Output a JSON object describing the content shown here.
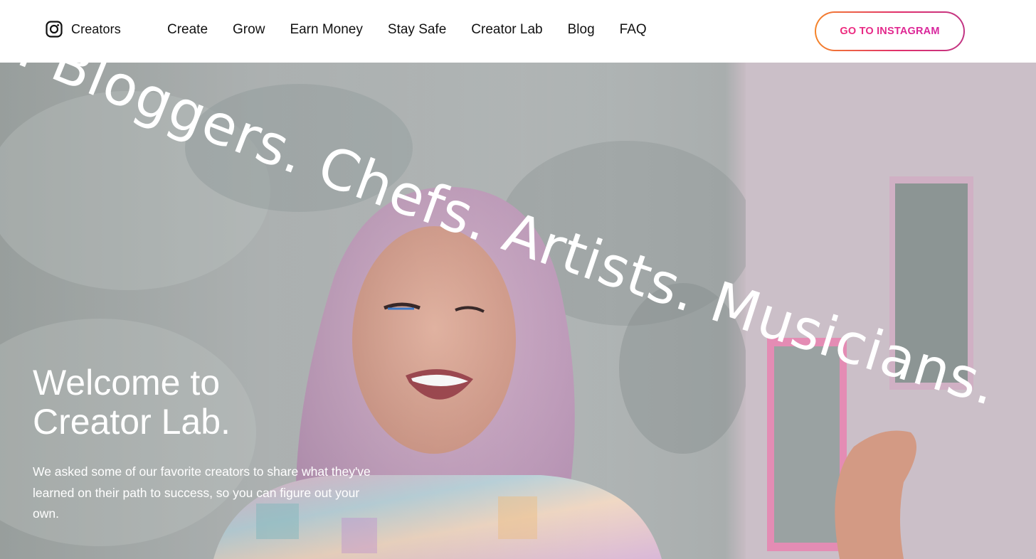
{
  "header": {
    "brand": {
      "icon": "instagram-icon",
      "label": "Creators"
    },
    "nav": [
      {
        "label": "Create"
      },
      {
        "label": "Grow"
      },
      {
        "label": "Earn Money"
      },
      {
        "label": "Stay Safe"
      },
      {
        "label": "Creator Lab"
      },
      {
        "label": "Blog"
      },
      {
        "label": "FAQ"
      }
    ],
    "cta_label": "GO TO INSTAGRAM"
  },
  "hero": {
    "curved_text": ". Bloggers. Chefs. Artists. Musicians.",
    "title_line1": "Welcome to",
    "title_line2": "Creator Lab.",
    "description": "We asked some of our favorite creators to share what they've learned on their path to success, so you can figure out your own."
  },
  "colors": {
    "cta_gradient_start": "#f58529",
    "cta_gradient_end": "#c13584",
    "cta_text": "#e1306c"
  }
}
